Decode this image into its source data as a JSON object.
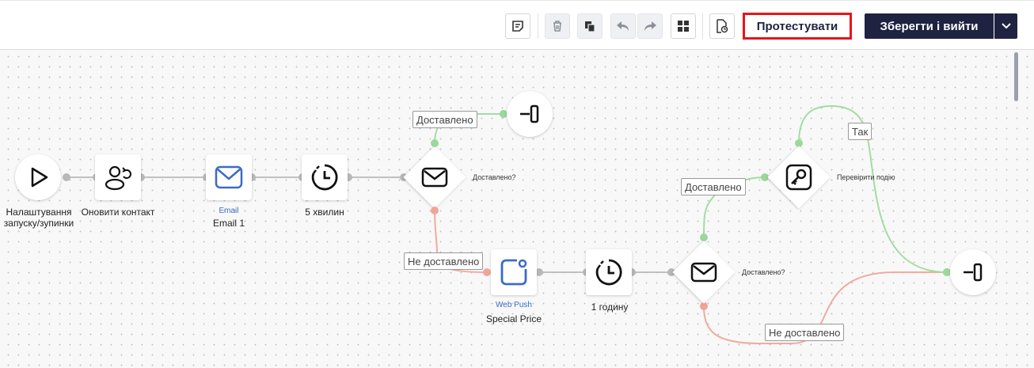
{
  "toolbar": {
    "test_label": "Протестувати",
    "save_label": "Зберегти і вийти",
    "icons": [
      "note-icon",
      "trash-icon",
      "copy-icon",
      "undo-icon",
      "redo-icon",
      "layout-grid-icon",
      "restore-file-icon",
      "chevron-down-icon"
    ]
  },
  "nodes": {
    "start": {
      "label_line1": "Налаштування",
      "label_line2": "запуску/зупинки"
    },
    "update_contact": {
      "label": "Оновити контакт"
    },
    "email": {
      "type": "Email",
      "label": "Email 1"
    },
    "wait1": {
      "label": "5 хвилин"
    },
    "cond1": {
      "label": "Доставлено?"
    },
    "webpush": {
      "type": "Web Push",
      "label": "Special Price"
    },
    "wait2": {
      "label": "1 годину"
    },
    "cond2": {
      "label": "Доставлено?"
    },
    "event_check": {
      "label": "Перевірити подію"
    }
  },
  "tags": {
    "delivered_1": "Доставлено",
    "not_delivered_1": "Не доставлено",
    "delivered_2": "Доставлено",
    "not_delivered_2": "Не доставлено",
    "yes": "Так"
  },
  "colors": {
    "accent": "#1d2341",
    "highlight": "#e8141c",
    "success": "#9bd89b",
    "failure": "#f0a59a",
    "link": "#3b6cc4"
  }
}
